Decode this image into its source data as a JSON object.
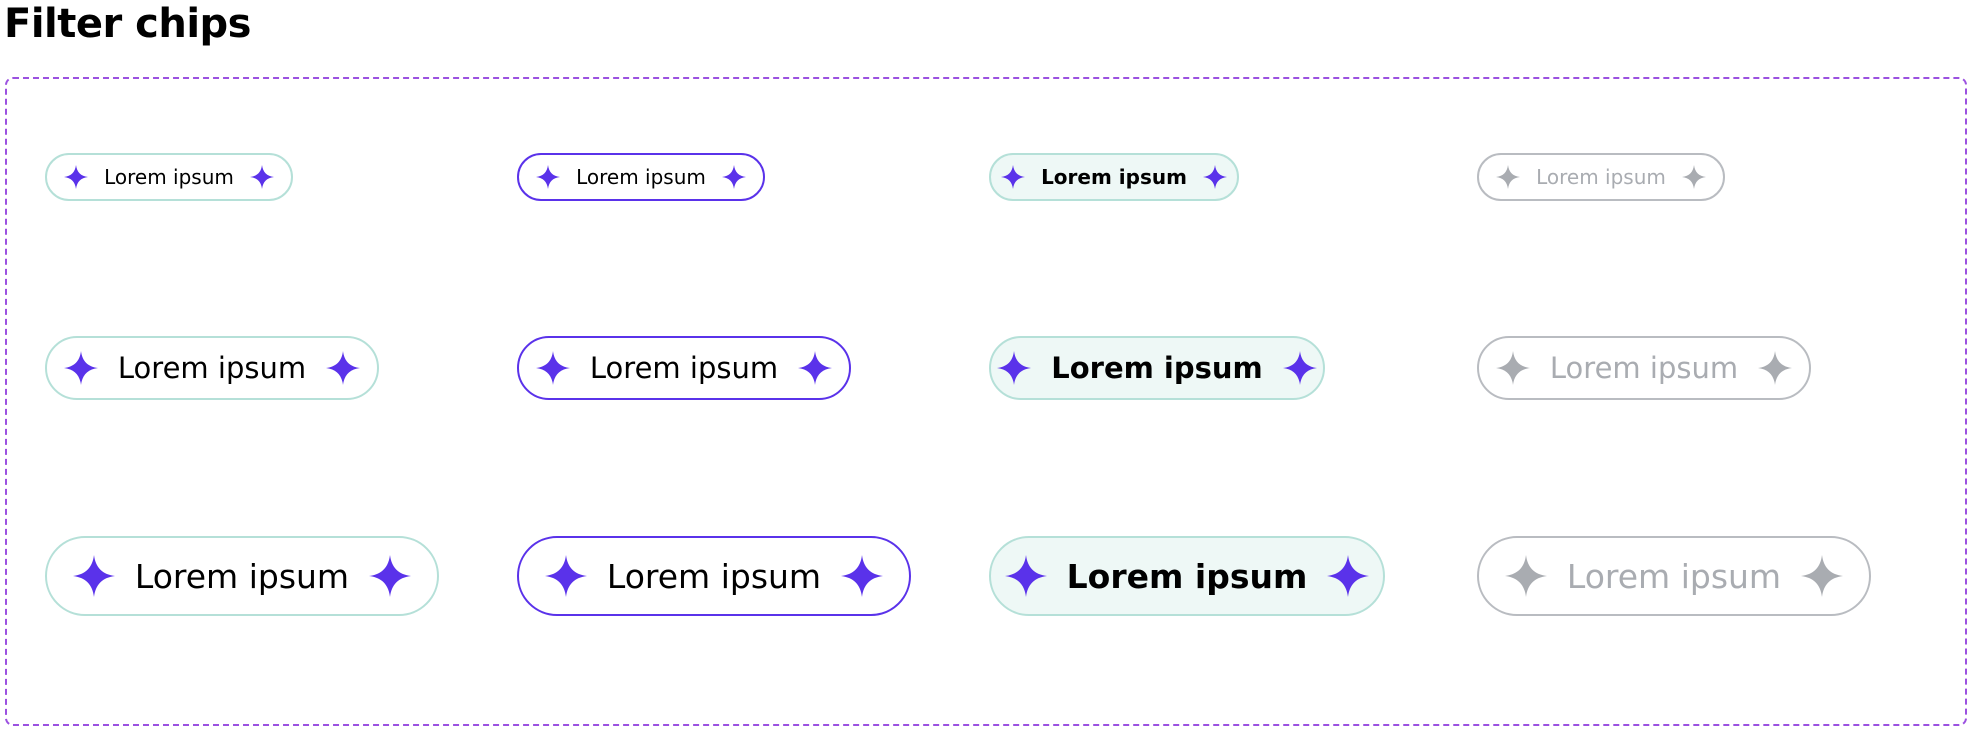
{
  "page_title": "Filter chips",
  "colors": {
    "icon_active": "#5a32ea",
    "icon_disabled": "#a9acb1",
    "frame_border": "#9b51e0",
    "default_border": "#b5e0d8",
    "focused_border": "#5a32ea",
    "selected_background": "#eef8f6",
    "disabled_border": "#b9bcc1",
    "disabled_text": "#a9acb1"
  },
  "chips": {
    "small": {
      "default": {
        "label": "Lorem ipsum",
        "leading_icon": "sparkle-icon",
        "trailing_icon": "sparkle-icon"
      },
      "focused": {
        "label": "Lorem ipsum",
        "leading_icon": "sparkle-icon",
        "trailing_icon": "sparkle-icon"
      },
      "selected": {
        "label": "Lorem ipsum",
        "leading_icon": "sparkle-icon",
        "trailing_icon": "sparkle-icon"
      },
      "disabled": {
        "label": "Lorem ipsum",
        "leading_icon": "sparkle-icon",
        "trailing_icon": "sparkle-icon"
      }
    },
    "medium": {
      "default": {
        "label": "Lorem ipsum",
        "leading_icon": "sparkle-icon",
        "trailing_icon": "sparkle-icon"
      },
      "focused": {
        "label": "Lorem ipsum",
        "leading_icon": "sparkle-icon",
        "trailing_icon": "sparkle-icon"
      },
      "selected": {
        "label": "Lorem ipsum",
        "leading_icon": "sparkle-icon",
        "trailing_icon": "sparkle-icon"
      },
      "disabled": {
        "label": "Lorem ipsum",
        "leading_icon": "sparkle-icon",
        "trailing_icon": "sparkle-icon"
      }
    },
    "large": {
      "default": {
        "label": "Lorem ipsum",
        "leading_icon": "sparkle-icon",
        "trailing_icon": "sparkle-icon"
      },
      "focused": {
        "label": "Lorem ipsum",
        "leading_icon": "sparkle-icon",
        "trailing_icon": "sparkle-icon"
      },
      "selected": {
        "label": "Lorem ipsum",
        "leading_icon": "sparkle-icon",
        "trailing_icon": "sparkle-icon"
      },
      "disabled": {
        "label": "Lorem ipsum",
        "leading_icon": "sparkle-icon",
        "trailing_icon": "sparkle-icon"
      }
    }
  }
}
